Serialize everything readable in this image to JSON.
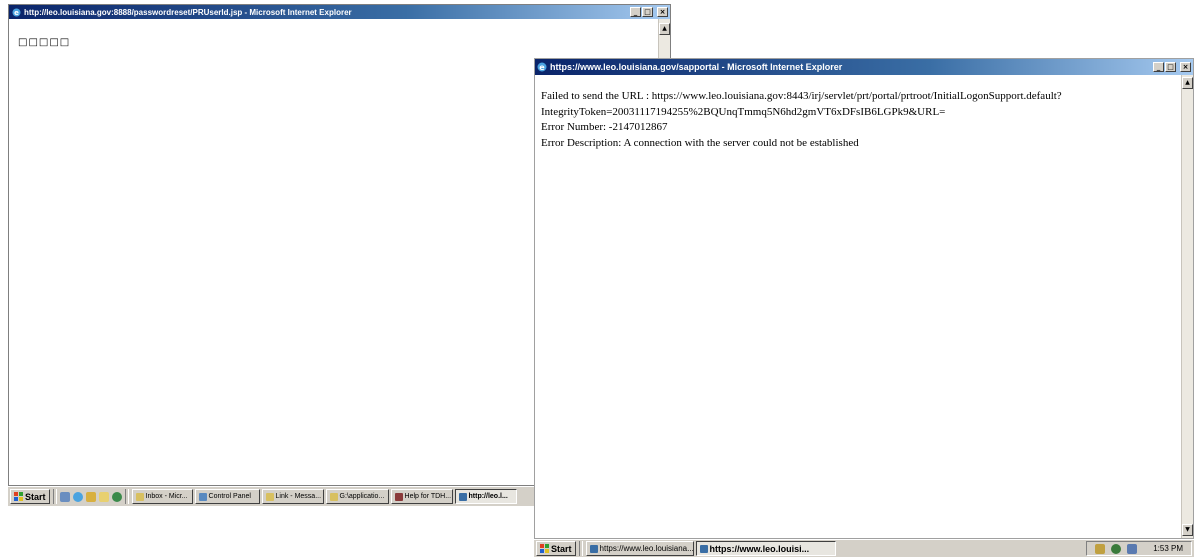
{
  "window1": {
    "title": "http://leo.louisiana.gov:8888/passwordreset/PRUserId.jsp - Microsoft Internet Explorer",
    "body_text": "□□□□□",
    "controls": [
      "_",
      "□",
      "×"
    ]
  },
  "window2": {
    "title": "https://www.leo.louisiana.gov/sapportal - Microsoft Internet Explorer",
    "lines": [
      "Failed to send the URL : https://www.leo.louisiana.gov:8443/irj/servlet/prt/portal/prtroot/InitialLogonSupport.default?",
      "IntegrityToken=20031117194255%2BQUnqTmmq5N6hd2gmVT6xDFsIB6LGPk9&URL=",
      "Error Number: -2147012867",
      "Error Description: A connection with the server could not be established"
    ],
    "controls": [
      "_",
      "□",
      "×"
    ]
  },
  "taskbar1": {
    "start_label": "Start",
    "tasks": [
      {
        "label": "Inbox - Micr...",
        "icon": "envelope-icon"
      },
      {
        "label": "Control Panel",
        "icon": "control-panel-icon"
      },
      {
        "label": "Link - Messa...",
        "icon": "envelope-icon"
      },
      {
        "label": "G:\\applicatio...",
        "icon": "folder-icon"
      },
      {
        "label": "Help for TDH...",
        "icon": "help-icon"
      },
      {
        "label": "http://leo.l...",
        "icon": "ie-icon",
        "active": true
      }
    ]
  },
  "taskbar2": {
    "start_label": "Start",
    "tasks": [
      {
        "label": "https://www.leo.louisiana....",
        "icon": "ie-icon"
      },
      {
        "label": "https://www.leo.louisi...",
        "icon": "ie-icon",
        "active": true
      }
    ],
    "clock": "1:53 PM"
  },
  "colors": {
    "titlebar_start": "#0a246a",
    "titlebar_end": "#a6caf0",
    "chrome": "#d4d0c8"
  }
}
